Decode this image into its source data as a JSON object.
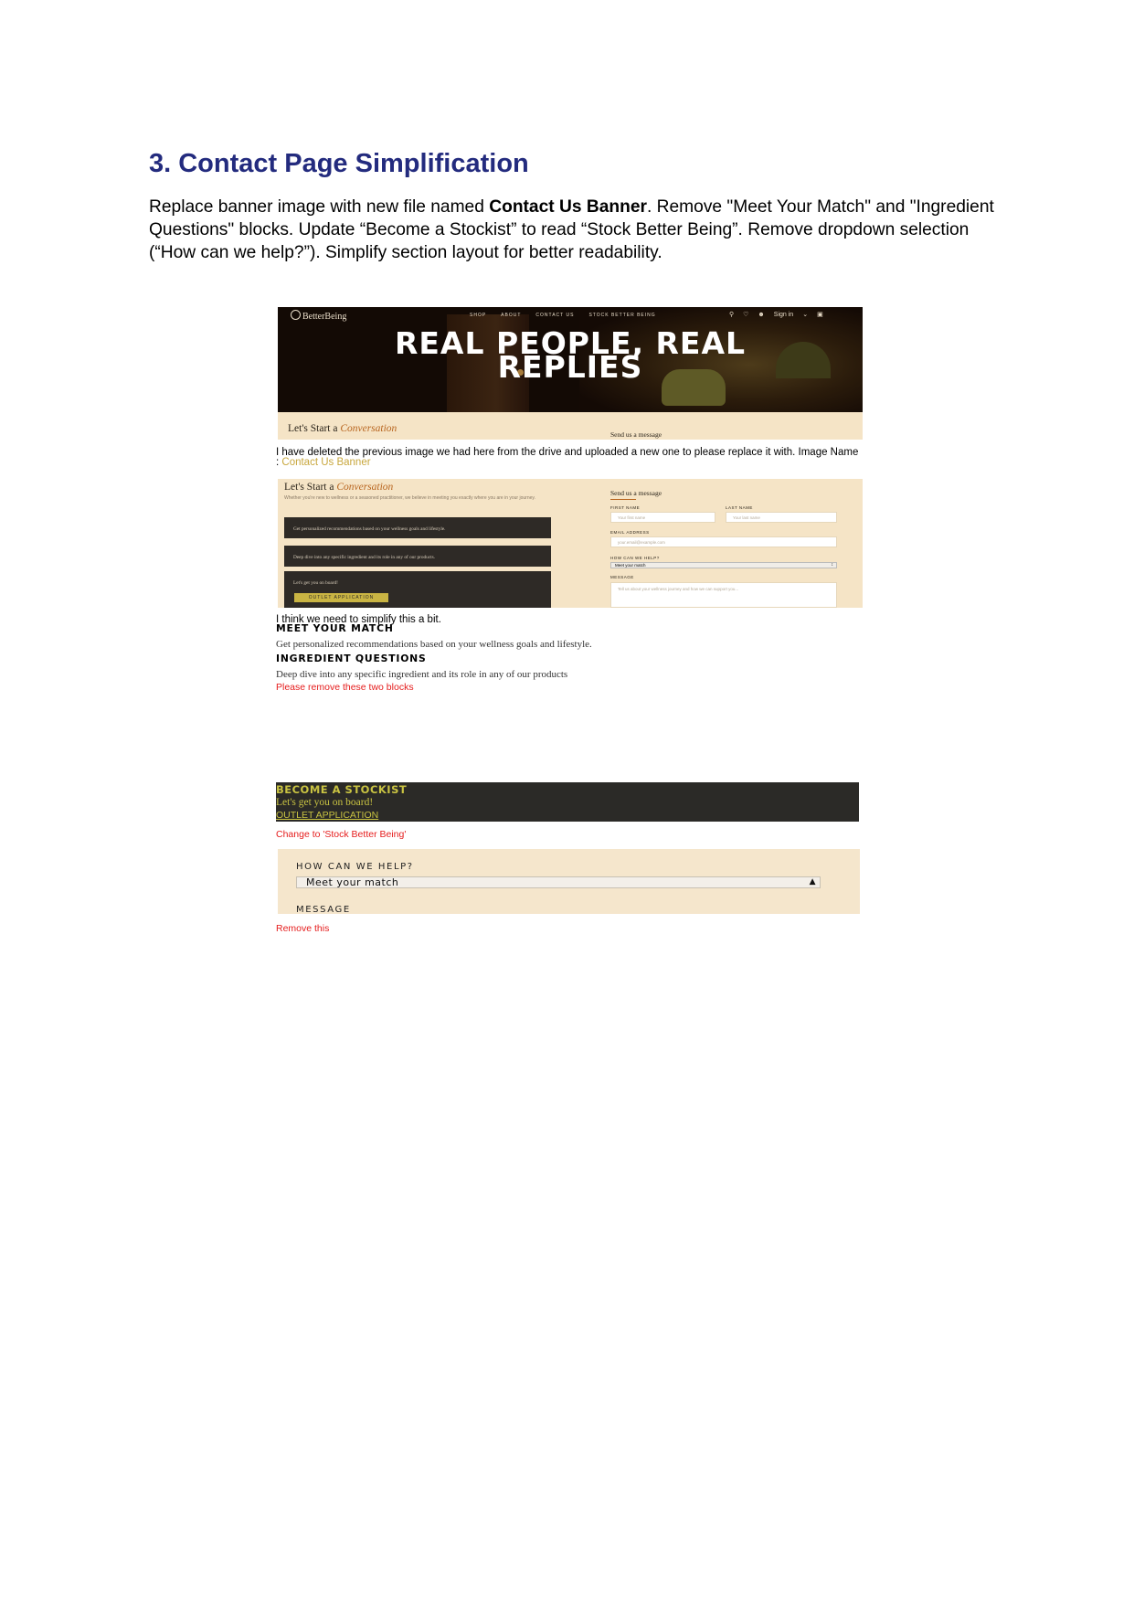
{
  "section": {
    "heading": "3. Contact Page Simplification",
    "intro": {
      "part1": "Replace banner image with new file named ",
      "bold": "Contact Us Banner",
      "part2": ". Remove \"Meet Your Match\" and \"Ingredient Questions\" blocks. Update “Become a Stockist” to read “Stock Better Being”. Remove dropdown selection (“How can we help?”). Simplify section layout for better readability."
    }
  },
  "banner": {
    "logo": "BetterBeing",
    "nav": [
      "SHOP",
      "ABOUT",
      "CONTACT US",
      "STOCK BETTER BEING"
    ],
    "sign_in": "Sign in",
    "title_line1": "REAL PEOPLE, REAL",
    "title_line2": "REPLIES",
    "strip_title": "Let's Start a ",
    "strip_title_italic": "Conversation",
    "strip_right": "Send us a message"
  },
  "note1": {
    "text": "I have deleted the previous image we had here from the drive and uploaded a new one to please replace it with. Image Name : ",
    "highlight": "Contact Us Banner"
  },
  "form": {
    "title": "Let's Start a ",
    "title_italic": "Conversation",
    "subtitle": "Whether you're new to wellness or a seasoned practitioner, we believe in meeting you exactly where you are in your journey.",
    "block1": "Get personalized recommendations based on your wellness goals and lifestyle.",
    "block2": "Deep dive into any specific ingredient and its role in any of our products.",
    "block3": "Let's get you on board!",
    "block3_button": "OUTLET APPLICATION",
    "right_title": "Send us a message",
    "first_name_label": "FIRST NAME",
    "first_name_placeholder": "Your first name",
    "last_name_label": "LAST NAME",
    "last_name_placeholder": "Your last name",
    "email_label": "EMAIL ADDRESS",
    "email_placeholder": "your.email@example.com",
    "help_label": "HOW CAN WE HELP?",
    "help_value": "Meet your match",
    "message_label": "MESSAGE",
    "message_placeholder": "Tell us about your wellness journey and how we can support you..."
  },
  "note2": "I think we need to simplify this a bit.",
  "blocks": {
    "meet_title": "MEET YOUR MATCH",
    "meet_text": "Get personalized recommendations based on your wellness goals and lifestyle.",
    "ingredient_title": "INGREDIENT QUESTIONS",
    "ingredient_text": "Deep dive into any specific ingredient and its role in any of our products",
    "remove_note": "Please remove these two blocks"
  },
  "stockist": {
    "title": "BECOME A STOCKIST",
    "subtitle": "Let's get you on board!",
    "link": "OUTLET APPLICATION",
    "note": "Change to 'Stock Better Being'"
  },
  "help": {
    "label": "HOW CAN WE HELP?",
    "selected": "Meet your match",
    "message_label": "MESSAGE",
    "note": "Remove this"
  },
  "colors": {
    "heading": "#232b7e",
    "annotation_red": "#e51c1c",
    "highlight_gold": "#c8a73e",
    "form_bg": "#f5e4c6",
    "dark_block": "#2e2a26"
  }
}
